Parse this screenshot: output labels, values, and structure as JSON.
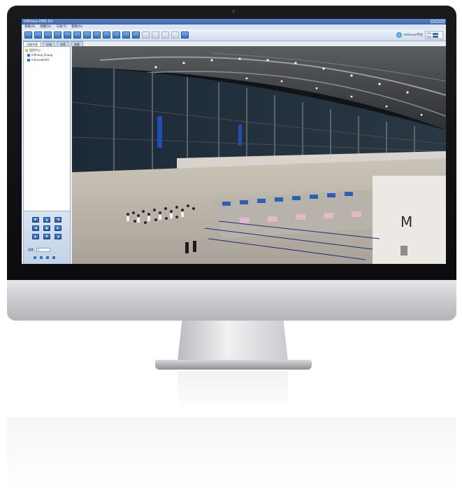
{
  "app": {
    "title": "Infinova DMS Dir",
    "menu": [
      "系统(S)",
      "视图(V)",
      "工具(T)",
      "帮助(H)"
    ]
  },
  "toolbar": {
    "status_text": "Infinova平台",
    "panel_rows": [
      "CPU:",
      "内存:"
    ]
  },
  "tabs": [
    "设备列表",
    "分组",
    "远程",
    "地图"
  ],
  "device_tree": [
    {
      "label": "监控中心",
      "icon": "folder-icon"
    },
    {
      "label": "Infinova_Group",
      "icon": "camera-icon"
    },
    {
      "label": "e-Encoder01",
      "icon": "camera-icon"
    }
  ],
  "ptz": {
    "speed_label": "速度",
    "speed_value": "5"
  },
  "scene": {
    "gate_sign": "M"
  },
  "colors": {
    "title_bar": "#3e66ad",
    "toolbar_button": "#2f6fc0",
    "bezel": "#111113"
  }
}
